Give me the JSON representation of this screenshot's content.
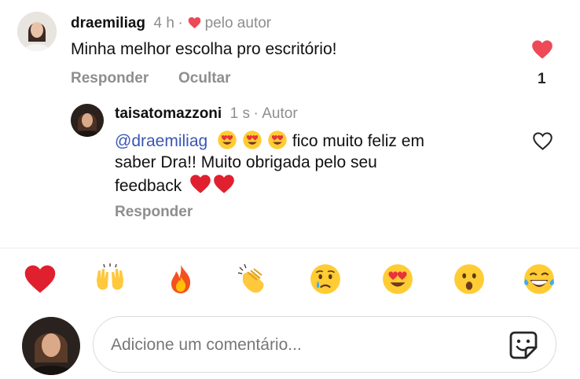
{
  "comment": {
    "username": "draemiliag",
    "time": "4 h",
    "dot": "·",
    "liked_by_author": "pelo autor",
    "text": "Minha melhor escolha pro escritório!",
    "reply_label": "Responder",
    "hide_label": "Ocultar",
    "like_count": "1",
    "like_color": "#ed4956"
  },
  "reply": {
    "username": "taisatomazzoni",
    "time": "1 s",
    "dot": "·",
    "author_badge": "Autor",
    "mention": "@draemiliag",
    "text_after_emojis": " fico muito feliz em",
    "line2": "saber Dra!! Muito obrigada pelo seu",
    "line3": "feedback",
    "reply_label": "Responder",
    "mention_color": "#3a55b4"
  },
  "emoji_bar": {
    "items": [
      "red-heart",
      "raising-hands",
      "fire",
      "clapping-hands",
      "crying-face",
      "heart-eyes-face",
      "astonished-face",
      "laughing-tears-face"
    ]
  },
  "composer": {
    "placeholder": "Adicione um comentário...",
    "sticker_icon": "sticker-icon"
  }
}
